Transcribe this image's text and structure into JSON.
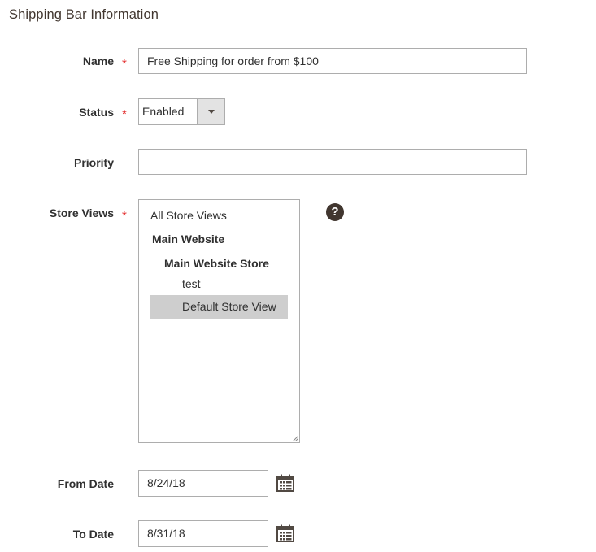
{
  "section": {
    "title": "Shipping Bar Information"
  },
  "fields": {
    "name": {
      "label": "Name",
      "required_mark": "*",
      "value": "Free Shipping for order from $100"
    },
    "status": {
      "label": "Status",
      "required_mark": "*",
      "value": "Enabled"
    },
    "priority": {
      "label": "Priority",
      "value": ""
    },
    "store_views": {
      "label": "Store Views",
      "required_mark": "*",
      "options": {
        "all": "All Store Views",
        "website": "Main Website",
        "store": "Main Website Store",
        "test": "test",
        "default": "Default Store View"
      },
      "selected": "Default Store View",
      "help": "?"
    },
    "from_date": {
      "label": "From Date",
      "value": "8/24/18"
    },
    "to_date": {
      "label": "To Date",
      "value": "8/31/18"
    }
  },
  "icons": {
    "help": "question-circle-icon",
    "calendar": "calendar-icon",
    "dropdown": "caret-down-icon"
  },
  "colors": {
    "required": "#e22626",
    "selected_bg": "#cecece",
    "border": "#adadad",
    "icon": "#514943"
  }
}
